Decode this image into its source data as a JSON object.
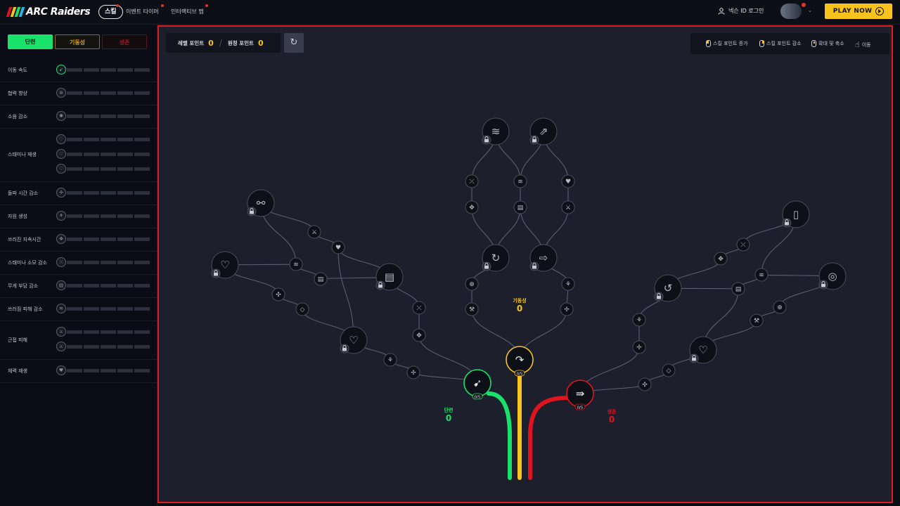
{
  "topbar": {
    "logo_text": "ARC Raiders",
    "nav": [
      {
        "label": "스킬",
        "active": true
      },
      {
        "label": "이벤트 타이머",
        "active": false
      },
      {
        "label": "인터랙티브 맵",
        "active": false
      }
    ],
    "login_label": "넥슨 ID 로그인",
    "play_label": "PLAY NOW"
  },
  "sidebar": {
    "tabs": [
      {
        "label": "단련",
        "color": "#19e26a"
      },
      {
        "label": "기동성",
        "color": "#d7a21a"
      },
      {
        "label": "생존",
        "color": "#9a1c24"
      }
    ],
    "rows": [
      {
        "label": "이동 속도",
        "skills": 1
      },
      {
        "label": "협력 향상",
        "skills": 1
      },
      {
        "label": "소음 감소",
        "skills": 1
      },
      {
        "label": "스태미나 재생",
        "skills": 3
      },
      {
        "label": "돌파 시간 감소",
        "skills": 1
      },
      {
        "label": "자원 생성",
        "skills": 1
      },
      {
        "label": "쓰러진 지속시간",
        "skills": 1
      },
      {
        "label": "스태미나 소모 감소",
        "skills": 1
      },
      {
        "label": "무게 부담 감소",
        "skills": 1
      },
      {
        "label": "쓰러짐 피해 감소",
        "skills": 1
      },
      {
        "label": "근접 피해",
        "skills": 2
      },
      {
        "label": "체력 재생",
        "skills": 1
      }
    ]
  },
  "main": {
    "level_points_label": "레벨 포인트",
    "level_points": "0",
    "expedition_points_label": "원정 포인트",
    "expedition_points": "0",
    "hints": [
      {
        "label": "스킬 포인트 증가",
        "icon": "mouse-left-icon"
      },
      {
        "label": "스킬 포인트 감소",
        "icon": "mouse-right-icon"
      },
      {
        "label": "확대 및 축소",
        "icon": "mouse-wheel-icon"
      },
      {
        "label": "이동",
        "icon": "hand-drag-icon"
      }
    ],
    "branches": [
      {
        "label": "단련",
        "value": "0",
        "color": "#19e26a",
        "root_level": "0/5"
      },
      {
        "label": "기동성",
        "value": "0",
        "color": "#f7c31c",
        "root_level": "0/5"
      },
      {
        "label": "생존",
        "value": "0",
        "color": "#e0141e",
        "root_level": "0/5"
      }
    ]
  }
}
